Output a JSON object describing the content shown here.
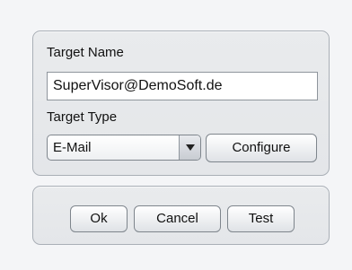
{
  "target": {
    "name_label": "Target Name",
    "name_value": "SuperVisor@DemoSoft.de",
    "type_label": "Target Type",
    "type_selected": "E-Mail",
    "configure_label": "Configure"
  },
  "actions": {
    "ok_label": "Ok",
    "cancel_label": "Cancel",
    "test_label": "Test"
  },
  "icons": {
    "dropdown": "chevron-down-icon"
  }
}
